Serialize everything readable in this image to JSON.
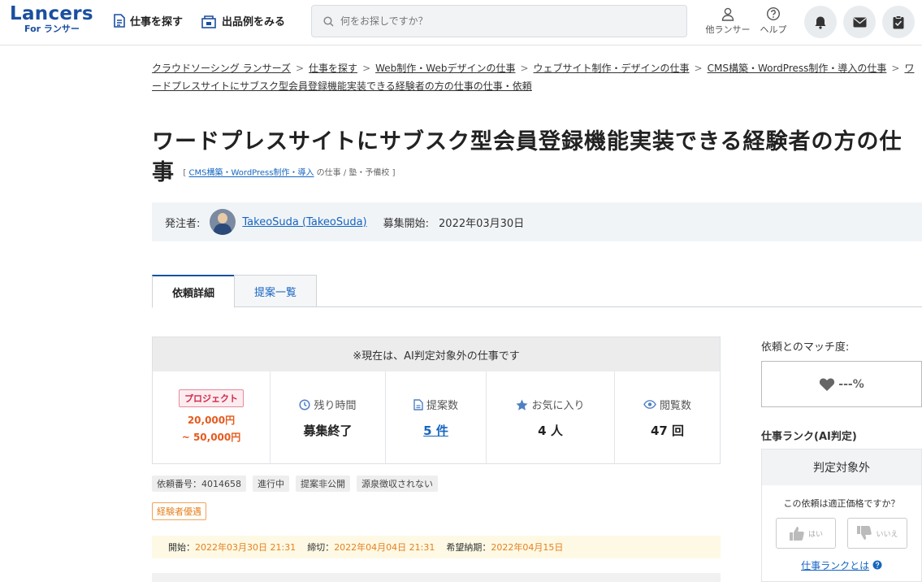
{
  "header": {
    "logo_main": "Lancers",
    "logo_sub": "For ランサー",
    "nav_find_jobs": "仕事を探す",
    "nav_portfolio": "出品例をみる",
    "search_placeholder": "何をお探しですか？",
    "other_lancer": "他ランサー",
    "help": "ヘルプ"
  },
  "breadcrumb": {
    "items": [
      "クラウドソーシング ランサーズ",
      "仕事を探す",
      "Web制作・Webデザインの仕事",
      "ウェブサイト制作・デザインの仕事",
      "CMS構築・WordPress制作・導入の仕事",
      "ワードプレスサイトにサブスク型会員登録機能実装できる経験者の方の仕事の仕事・依頼"
    ]
  },
  "job": {
    "title": "ワードプレスサイトにサブスク型会員登録機能実装できる経験者の方の仕事",
    "cat_open": "[",
    "category_link": "CMS構築・WordPress制作・導入",
    "category_rest": "の仕事 / 塾・予備校",
    "cat_close": "]"
  },
  "client": {
    "label": "発注者:",
    "name": "TakeoSuda (TakeoSuda)",
    "start_label": "募集開始:",
    "start_date": "2022年03月30日"
  },
  "tabs": {
    "detail": "依頼詳細",
    "proposals": "提案一覧"
  },
  "card": {
    "notice": "※現在は、AI判定対象外の仕事です",
    "type_badge": "プロジェクト",
    "price_min": "20,000円",
    "price_max": "~ 50,000円",
    "remaining_label": "残り時間",
    "remaining_value": "募集終了",
    "proposals_label": "提案数",
    "proposals_value": "5 件",
    "favorites_label": "お気に入り",
    "favorites_value": "4 人",
    "views_label": "閲覧数",
    "views_value": "47 回"
  },
  "tags": [
    "依頼番号：4014658",
    "進行中",
    "提案非公開",
    "源泉徴収されない"
  ],
  "tag_experience": "経験者優遇",
  "dates": {
    "start_label": "開始：",
    "start_value": "2022年03月30日 21:31",
    "end_label": "締切：",
    "end_value": "2022年04月04日 21:31",
    "delivery_label": "希望納期：",
    "delivery_value": "2022年04月15日"
  },
  "sidebar": {
    "match_label": "依頼とのマッチ度:",
    "match_value": "---%",
    "rank_label": "仕事ランク(AI判定)",
    "rank_value": "判定対象外",
    "price_question": "この依頼は適正価格ですか？",
    "vote_yes": "はい",
    "vote_no": "いいえ",
    "rank_link": "仕事ランクとは"
  },
  "colors": {
    "brand": "#1a4fa0",
    "link": "#1565c0",
    "price": "#e65a1e",
    "date_value": "#e6801e"
  }
}
